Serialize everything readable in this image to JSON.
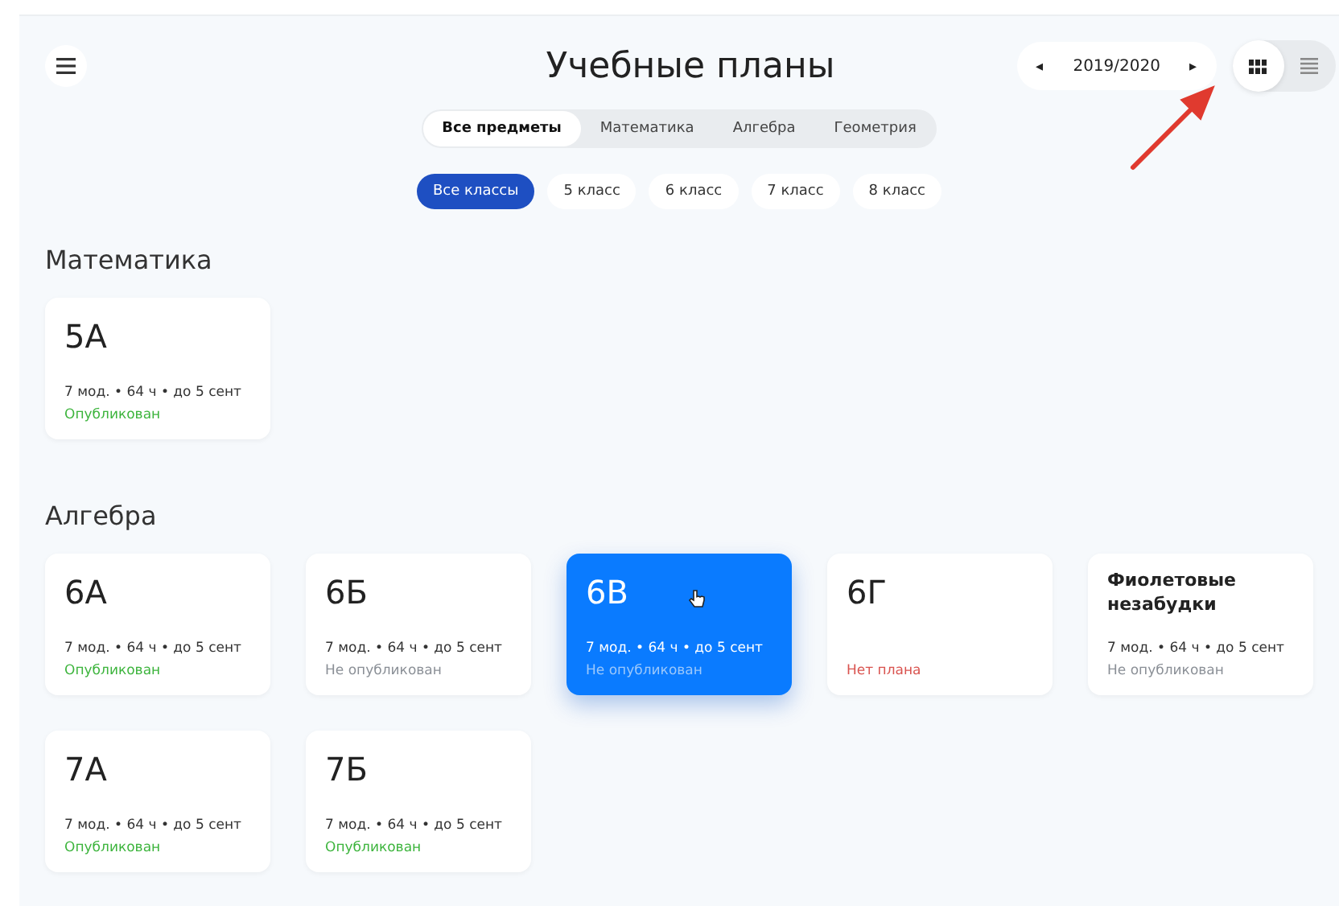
{
  "header": {
    "title": "Учебные планы",
    "year": "2019/2020",
    "prev_icon": "◂",
    "next_icon": "▸",
    "views": [
      {
        "kind": "grid",
        "selected": true
      },
      {
        "kind": "list",
        "selected": false
      }
    ]
  },
  "subject_tabs": [
    {
      "label": "Все предметы",
      "selected": true
    },
    {
      "label": "Математика",
      "selected": false
    },
    {
      "label": "Алгебра",
      "selected": false
    },
    {
      "label": "Геометрия",
      "selected": false
    }
  ],
  "class_filters": [
    {
      "label": "Все классы",
      "selected": true
    },
    {
      "label": "5 класс",
      "selected": false
    },
    {
      "label": "6 класс",
      "selected": false
    },
    {
      "label": "7 класс",
      "selected": false
    },
    {
      "label": "8 класс",
      "selected": false
    }
  ],
  "sections": [
    {
      "title": "Математика",
      "cards": [
        {
          "kind": "class",
          "title": "5А",
          "meta": "7 мод. • 64 ч • до 5 сент",
          "status": "Опубликован",
          "color": "#3cb43c",
          "selected": false
        }
      ]
    },
    {
      "title": "Алгебра",
      "cards": [
        {
          "kind": "class",
          "title": "6А",
          "meta": "7 мод. • 64 ч • до 5 сент",
          "status": "Опубликован",
          "color": "#3cb43c",
          "selected": false
        },
        {
          "kind": "class",
          "title": "6Б",
          "meta": "7 мод. • 64 ч • до 5 сент",
          "status": "Не опубликован",
          "color": "#8a8f96",
          "selected": false
        },
        {
          "kind": "class",
          "title": "6В",
          "meta": "7 мод. • 64 ч • до 5 сент",
          "status": "Не опубликован",
          "color": "#9cc8fb",
          "selected": true
        },
        {
          "kind": "class",
          "title": "6Г",
          "status": "Нет плана",
          "color": "#d9534f",
          "selected": false
        },
        {
          "kind": "group",
          "title": "Фиолетовые незабудки",
          "meta": "7 мод. • 64 ч • до 5 сент",
          "status": "Не опубликован",
          "color": "#8a8f96",
          "selected": false
        },
        {
          "kind": "class",
          "title": "7А",
          "meta": "7 мод. • 64 ч • до 5 сент",
          "status": "Опубликован",
          "color": "#3cb43c",
          "selected": false
        },
        {
          "kind": "class",
          "title": "7Б",
          "meta": "7 мод. • 64 ч • до 5 сент",
          "status": "Опубликован",
          "color": "#3cb43c",
          "selected": false
        }
      ]
    }
  ]
}
